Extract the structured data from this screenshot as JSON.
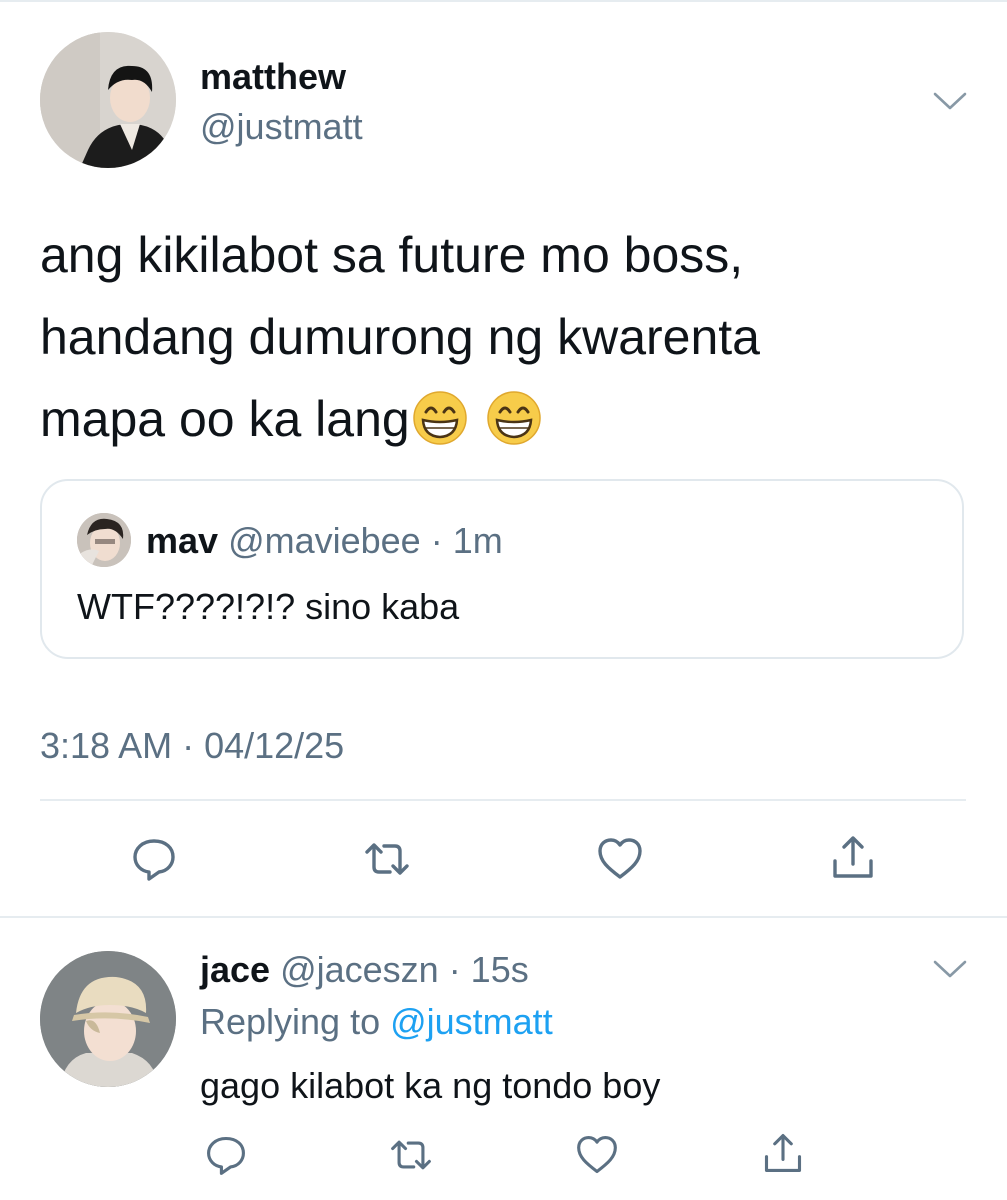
{
  "tweet": {
    "author_name": "matthew",
    "author_handle": "@justmatt",
    "text_lines": [
      "ang kikilabot sa future mo boss,",
      "handang dumurong ng kwarenta",
      "mapa oo ka lang"
    ],
    "emojis": [
      "grinning-face-with-smiling-eyes",
      "grinning-face-with-smiling-eyes"
    ],
    "timestamp": "3:18 AM · 04/12/25"
  },
  "quoted_tweet": {
    "author_name": "mav",
    "meta": " @maviebee · 1m",
    "text": "WTF????!?!? sino kaba"
  },
  "actions": [
    "reply-icon",
    "retweet-icon",
    "like-icon",
    "share-icon"
  ],
  "reply": {
    "author_name": "jace",
    "meta": " @jaceszn · 15s",
    "replying_prefix": "Replying to ",
    "replying_mention": "@justmatt",
    "text": "gago kilabot ka ng tondo boy"
  },
  "colors": {
    "secondary_text": "#5b7083",
    "link": "#1da1f2",
    "divider": "#e6ecf0"
  }
}
